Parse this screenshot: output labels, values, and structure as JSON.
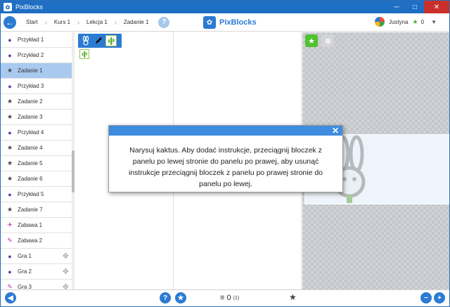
{
  "window": {
    "title": "PixBlocks",
    "icon": "bunny-icon"
  },
  "navbar": {
    "breadcrumb": [
      "Start",
      "Kurs 1",
      "Lekcja 1",
      "Zadanie 1"
    ],
    "help": "?",
    "brand": "PixBlocks",
    "user": {
      "name": "Justyna",
      "points": "0"
    }
  },
  "sidebar": {
    "items": [
      {
        "label": "Przykład 1",
        "icon": "lightbulb-icon",
        "color": "#5b3fa5"
      },
      {
        "label": "Przykład 2",
        "icon": "lightbulb-icon",
        "color": "#5b3fa5"
      },
      {
        "label": "Zadanie 1",
        "icon": "star-icon",
        "color": "#444444",
        "active": true
      },
      {
        "label": "Przykład 3",
        "icon": "lightbulb-icon",
        "color": "#5b3fa5"
      },
      {
        "label": "Zadanie 2",
        "icon": "star-icon",
        "color": "#444444"
      },
      {
        "label": "Zadanie 3",
        "icon": "star-icon",
        "color": "#444444"
      },
      {
        "label": "Przykład 4",
        "icon": "lightbulb-icon",
        "color": "#5b3fa5"
      },
      {
        "label": "Zadanie 4",
        "icon": "star-icon",
        "color": "#444444"
      },
      {
        "label": "Zadanie 5",
        "icon": "star-icon",
        "color": "#444444"
      },
      {
        "label": "Zadanie 6",
        "icon": "star-icon",
        "color": "#444444"
      },
      {
        "label": "Przykład 5",
        "icon": "lightbulb-icon",
        "color": "#5b3fa5"
      },
      {
        "label": "Zadanie 7",
        "icon": "star-icon",
        "color": "#444444"
      },
      {
        "label": "Zabawa 1",
        "icon": "bird-icon",
        "color": "#c12ea8"
      },
      {
        "label": "Zabawa 2",
        "icon": "pencil-icon",
        "color": "#c12ea8"
      },
      {
        "label": "Gra 1",
        "icon": "lightbulb-icon",
        "color": "#5b3fa5",
        "movable": true
      },
      {
        "label": "Gra 2",
        "icon": "lightbulb-icon",
        "color": "#5b3fa5",
        "movable": true
      },
      {
        "label": "Gra 3",
        "icon": "pencil-icon",
        "color": "#c12ea8",
        "movable": true
      }
    ]
  },
  "dialog": {
    "text": "Narysuj kaktus. Aby dodać instrukcje, przeciągnij bloczek z panelu po lewej stronie do panelu po prawej, aby usunąć instrukcje przeciągnij bloczek z panelu po prawej stronie do panelu po lewej."
  },
  "footer": {
    "count": "0",
    "count_small": "(1)"
  },
  "colors": {
    "accent": "#2b7bd3",
    "run": "#4fc22f",
    "active_row": "#a9c9ee"
  }
}
